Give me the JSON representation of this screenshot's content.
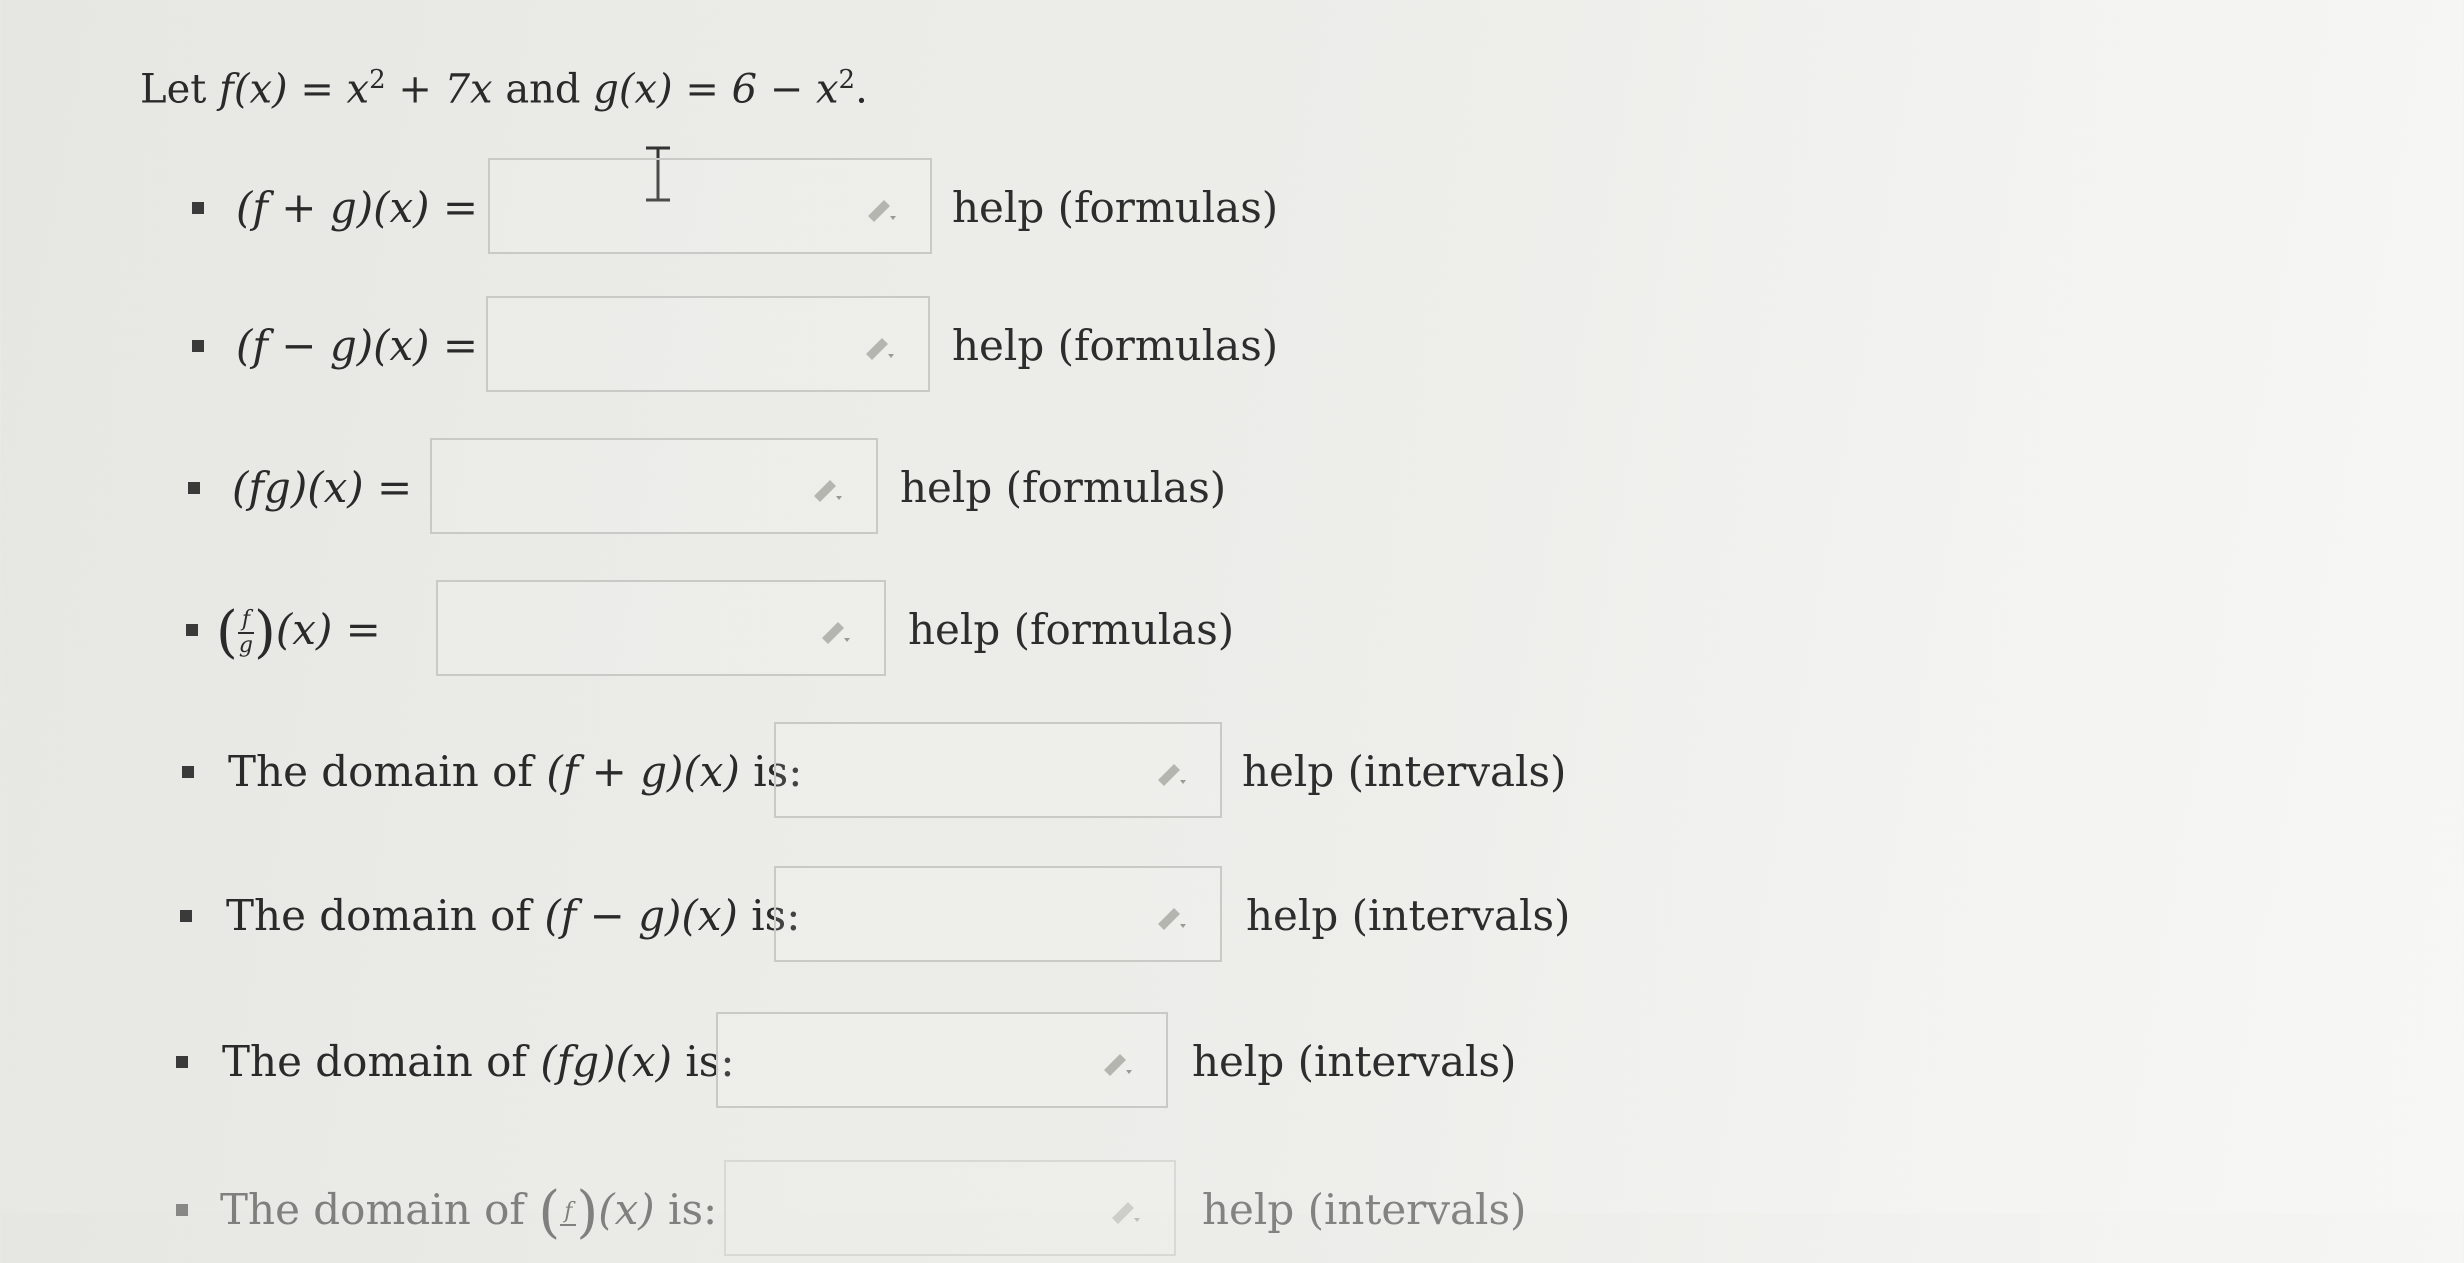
{
  "prompt": {
    "prefix": "Let ",
    "f_def": "f(x) = x",
    "f_sup": "2",
    "f_rest": " + 7x",
    "and": " and ",
    "g_def": "g(x) = 6 − x",
    "g_sup": "2",
    "end": "."
  },
  "items": [
    {
      "label": "(f + g)(x) =",
      "help": "help (formulas)"
    },
    {
      "label": "(f − g)(x) =",
      "help": "help (formulas)"
    },
    {
      "label": "(fg)(x) =",
      "help": "help (formulas)"
    },
    {
      "label_num": "f",
      "label_den": "g",
      "label_after": "(x) =",
      "help": "help (formulas)"
    },
    {
      "label_text": "The domain of ",
      "label_math": "(f + g)(x)",
      "label_end": " is:",
      "help": "help (intervals)"
    },
    {
      "label_text": "The domain of ",
      "label_math": "(f − g)(x)",
      "label_end": " is:",
      "help": "help (intervals)"
    },
    {
      "label_text": "The domain of ",
      "label_math": "(fg)(x)",
      "label_end": " is:",
      "help": "help (intervals)"
    },
    {
      "label_text": "The domain of ",
      "label_num": "f",
      "label_after": "(x)",
      "label_end": " is:",
      "help": "help (intervals)"
    }
  ],
  "icons": {
    "pencil": "pencil-icon",
    "cursor": "text-cursor-icon"
  },
  "colors": {
    "text": "#2a2a2a",
    "box_border": "#c9c9c5",
    "icon": "#b5b5b0"
  }
}
